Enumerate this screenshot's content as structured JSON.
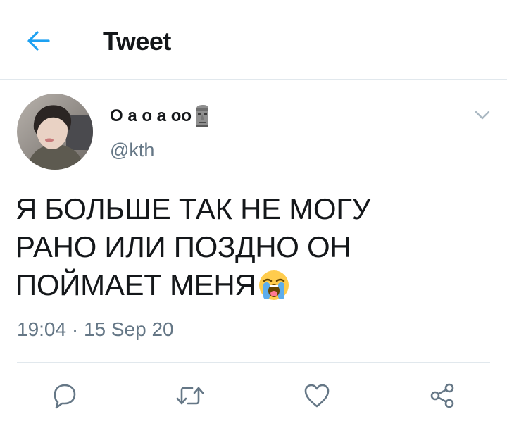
{
  "header": {
    "back_icon": "arrow-left-icon",
    "title": "Tweet"
  },
  "tweet": {
    "author": {
      "display_name": "О а о а оо",
      "name_emoji": "moai-emoji",
      "handle": "@kth"
    },
    "text_lines": [
      "Я БОЛЬШЕ ТАК НЕ МОГУ",
      "РАНО ИЛИ ПОЗДНО ОН",
      "ПОЙМАЕТ МЕНЯ"
    ],
    "text_emoji": "loudly-crying-face-emoji",
    "timestamp": "19:04 · 15 Sep 20"
  },
  "actions": [
    "reply-icon",
    "retweet-icon",
    "like-icon",
    "share-icon"
  ],
  "colors": {
    "accent": "#1da1f2",
    "text": "#14171a",
    "secondary": "#657786",
    "divider": "#e1e8ed"
  }
}
